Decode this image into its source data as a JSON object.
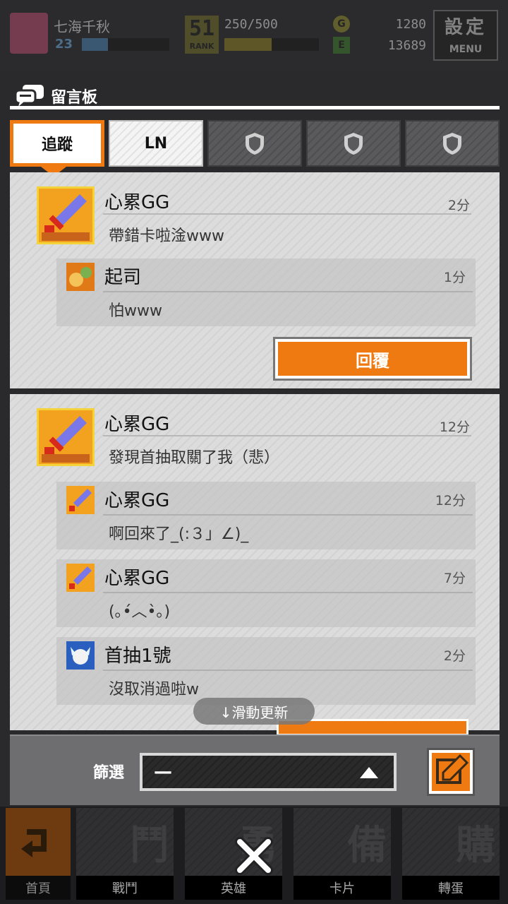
{
  "header": {
    "player_name": "七海千秋",
    "level": "23",
    "xp_fill": 0.3,
    "rank_num": "51",
    "rank_label": "RANK",
    "stamina": "250/500",
    "stamina_fill": 0.5,
    "coin_icon": "G",
    "gem_icon": "E",
    "coins": "1280",
    "gems": "13689",
    "menu_cn": "設定",
    "menu_en": "MENU"
  },
  "board": {
    "title": "留言板",
    "icon": "chat-bubbles-icon"
  },
  "tabs": [
    {
      "label": "追蹤",
      "state": "active"
    },
    {
      "label": "LN",
      "state": "normal"
    },
    {
      "label": "",
      "state": "locked",
      "icon": "shield-icon"
    },
    {
      "label": "",
      "state": "locked",
      "icon": "shield-icon"
    },
    {
      "label": "",
      "state": "locked",
      "icon": "shield-icon"
    }
  ],
  "threads": [
    {
      "post": {
        "name": "心累GG",
        "time": "2分",
        "body": "帶錯卡啦淦www",
        "avatar": "sword-card-avatar"
      },
      "replies": [
        {
          "name": "起司",
          "time": "1分",
          "body": "怕www",
          "avatar": "cheese-avatar"
        }
      ],
      "reply_button": "回覆"
    },
    {
      "post": {
        "name": "心累GG",
        "time": "12分",
        "body": "發現首抽取關了我（悲）",
        "avatar": "sword-card-avatar"
      },
      "replies": [
        {
          "name": "心累GG",
          "time": "12分",
          "body": "啊回來了_(:３」∠)_",
          "avatar": "sword-card-avatar"
        },
        {
          "name": "心累GG",
          "time": "7分",
          "body": "(｡•́︿•̀｡)",
          "avatar": "sword-card-avatar"
        },
        {
          "name": "首抽1號",
          "time": "2分",
          "body": "沒取消過啦w",
          "avatar": "blue-character-avatar"
        }
      ]
    }
  ],
  "refresh_hint": "↓滑動更新",
  "filter": {
    "label": "篩選",
    "value": "—"
  },
  "nav": {
    "home": "首頁",
    "items": [
      {
        "label": "戰鬥",
        "glyph": "鬥"
      },
      {
        "label": "英雄",
        "glyph": "勇"
      },
      {
        "label": "卡片",
        "glyph": "備"
      },
      {
        "label": "轉蛋",
        "glyph": "購"
      }
    ]
  },
  "colors": {
    "accent": "#f07a12",
    "panel": "#dcdcdc"
  }
}
